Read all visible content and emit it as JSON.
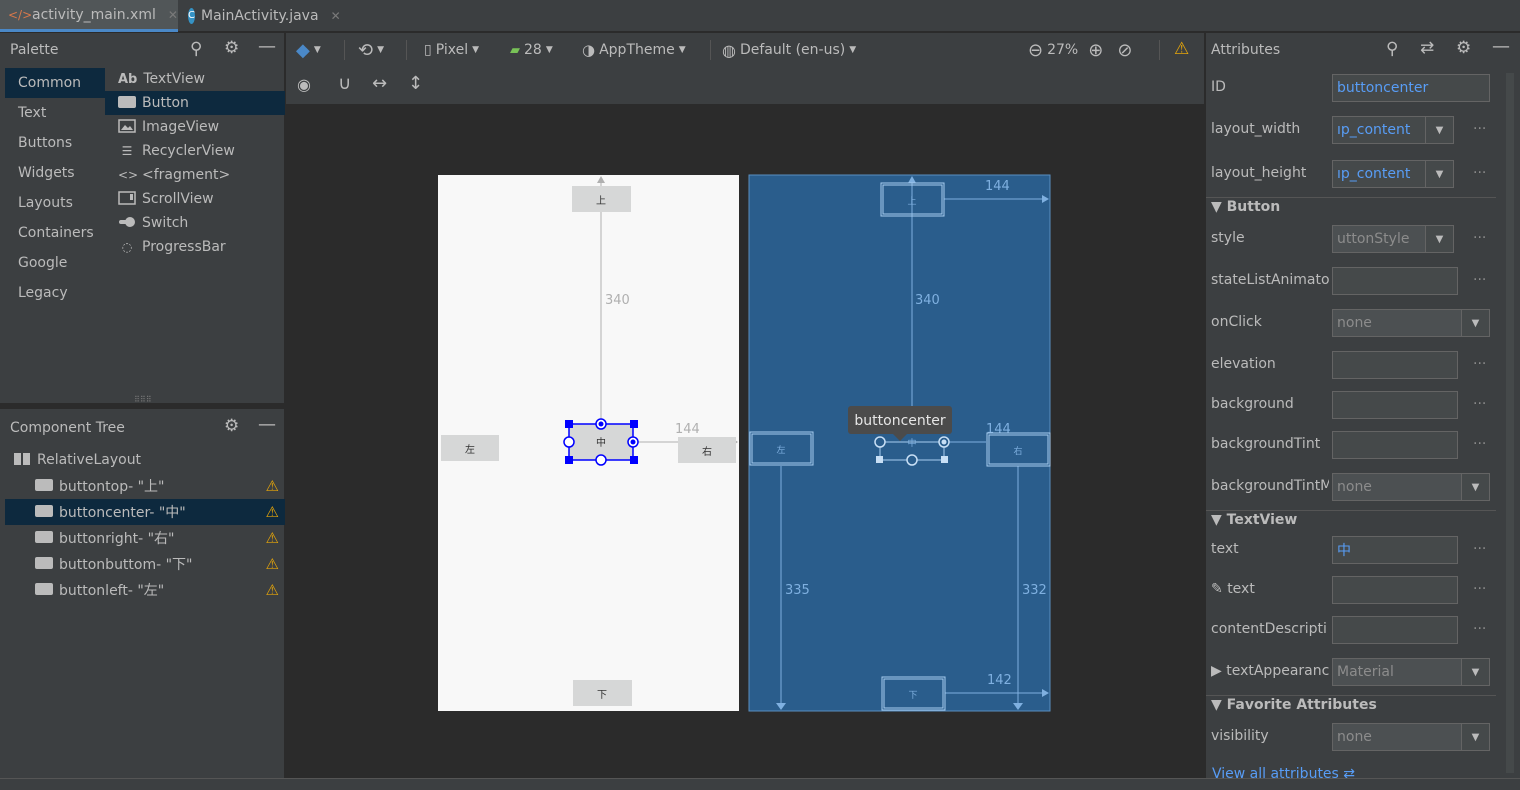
{
  "tabs": [
    {
      "label": "activity_main.xml",
      "active": true
    },
    {
      "label": "MainActivity.java",
      "active": false
    }
  ],
  "palette": {
    "title": "Palette",
    "categories": [
      "Common",
      "Text",
      "Buttons",
      "Widgets",
      "Layouts",
      "Containers",
      "Google",
      "Legacy"
    ],
    "items": [
      "TextView",
      "Button",
      "ImageView",
      "RecyclerView",
      "<fragment>",
      "ScrollView",
      "Switch",
      "ProgressBar"
    ],
    "textview_prefix": "Ab"
  },
  "component_tree": {
    "title": "Component Tree",
    "root": "RelativeLayout",
    "items": [
      "buttontop- \"上\"",
      "buttoncenter- \"中\"",
      "buttonright- \"右\"",
      "buttonbuttom- \"下\"",
      "buttonleft- \"左\""
    ]
  },
  "toolbar": {
    "device": "Pixel",
    "api": "28",
    "theme": "AppTheme",
    "locale": "Default (en-us)",
    "zoom": "27%"
  },
  "design": {
    "buttons": {
      "top": "上",
      "center": "中",
      "left": "左",
      "right": "右",
      "bottom": "下"
    },
    "dims": {
      "top_margin": "340",
      "right_margin": "144",
      "bp_top_margin": "340",
      "bp_right_top": "144",
      "bp_right_mid": "144",
      "bp_left_bottom": "335",
      "bp_right_bottom": "332",
      "bp_bottom_right": "142"
    },
    "tooltip": "buttoncenter"
  },
  "attributes": {
    "title": "Attributes",
    "id_label": "ID",
    "id_value": "buttoncenter",
    "layout_width_label": "layout_width",
    "layout_width_value": "ıp_content",
    "layout_height_label": "layout_height",
    "layout_height_value": "ıp_content",
    "section_button": "Button",
    "style_label": "style",
    "style_value": "uttonStyle",
    "state_label": "stateListAnimato",
    "onclick_label": "onClick",
    "onclick_value": "none",
    "elevation_label": "elevation",
    "background_label": "background",
    "bgtint_label": "backgroundTint",
    "bgtintmode_label": "backgroundTintM",
    "bgtintmode_value": "none",
    "section_textview": "TextView",
    "text_label": "text",
    "text_value": "中",
    "tools_text_label": "text",
    "contentdesc_label": "contentDescripti",
    "textappearance_label": "textAppearanc",
    "textappearance_value": "Material",
    "section_favorite": "Favorite Attributes",
    "visibility_label": "visibility",
    "visibility_value": "none",
    "view_all": "View all attributes"
  },
  "colors": {
    "accent": "#4a88c7",
    "blueprint": "#2a5d8c",
    "warning": "#e5a50a",
    "selection": "#0000ff"
  }
}
